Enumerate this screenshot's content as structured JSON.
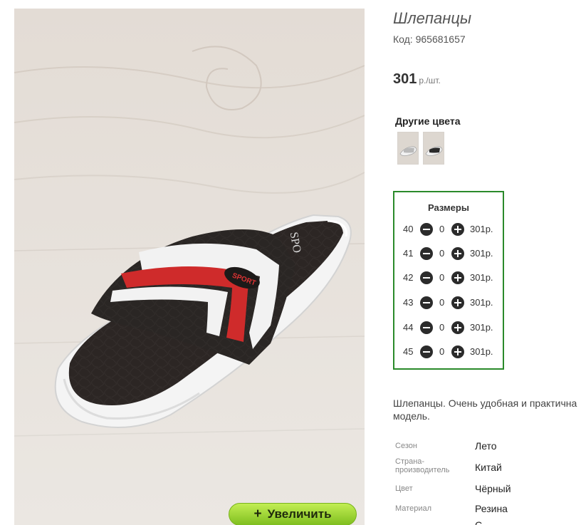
{
  "product": {
    "title": "Шлепанцы",
    "sku": "Код: 965681657",
    "price_amount": "301",
    "price_unit": "р./шт."
  },
  "image": {
    "zoom_label": "Увеличить",
    "zoom_icon": "plus-icon"
  },
  "other_colors": {
    "heading": "Другие цвета",
    "swatches": [
      {
        "name": "white-variant",
        "strap_color": "#bfbfbf"
      },
      {
        "name": "black-variant",
        "strap_color": "#2a2a2a"
      }
    ]
  },
  "sizes": {
    "heading": "Размеры",
    "rows": [
      {
        "size": "40",
        "qty": "0",
        "price": "301р."
      },
      {
        "size": "41",
        "qty": "0",
        "price": "301р."
      },
      {
        "size": "42",
        "qty": "0",
        "price": "301р."
      },
      {
        "size": "43",
        "qty": "0",
        "price": "301р."
      },
      {
        "size": "44",
        "qty": "0",
        "price": "301р."
      },
      {
        "size": "45",
        "qty": "0",
        "price": "301р."
      }
    ]
  },
  "description": {
    "line1": "Шлепанцы. Очень удобная и практична",
    "line2": "модель."
  },
  "specs": [
    {
      "name": "Сезон",
      "value": "Лето"
    },
    {
      "name": "Страна-производитель",
      "value": "Китай"
    },
    {
      "name": "Цвет",
      "value": "Чёрный"
    },
    {
      "name": "Материал",
      "value": "Резина"
    },
    {
      "name": "",
      "value": "С"
    }
  ],
  "colors": {
    "sizes_border": "#2a8a2a",
    "zoom_button": "#9fd43a",
    "product_red": "#d42d2d"
  }
}
